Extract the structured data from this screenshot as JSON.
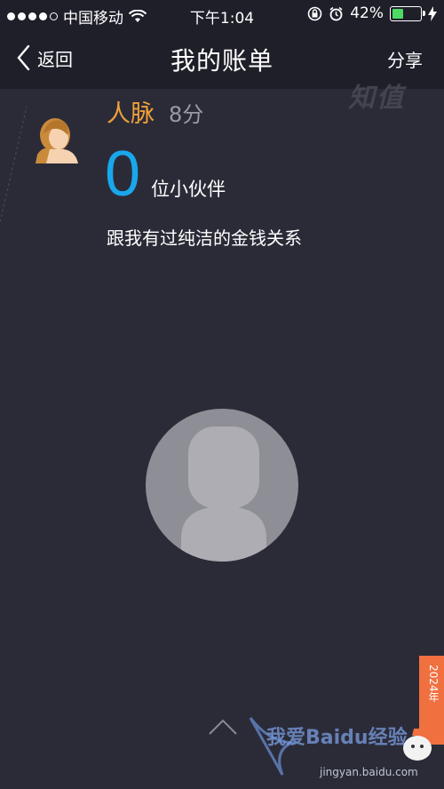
{
  "status_bar": {
    "carrier": "中国移动",
    "time": "下午1:04",
    "battery_percent": "42%",
    "battery_level": 0.42,
    "signal_bars_filled": 4,
    "signal_bars_total": 5
  },
  "nav": {
    "back_label": "返回",
    "title": "我的账单",
    "share_label": "分享"
  },
  "section": {
    "label": "人脉",
    "score": "8分",
    "count": "0",
    "count_unit": "位小伙伴",
    "description": "跟我有过纯洁的金钱关系"
  },
  "watermarks": {
    "top_right": "知值",
    "bottom_text": "我爱Baidu经验",
    "bottom_url": "jingyan.baidu.com",
    "ribbon_text": "2024年"
  },
  "colors": {
    "background": "#2b2b38",
    "bar": "#1f1f2a",
    "accent_orange": "#f0a138",
    "accent_blue": "#19a7ec",
    "battery_green": "#4cd964"
  }
}
